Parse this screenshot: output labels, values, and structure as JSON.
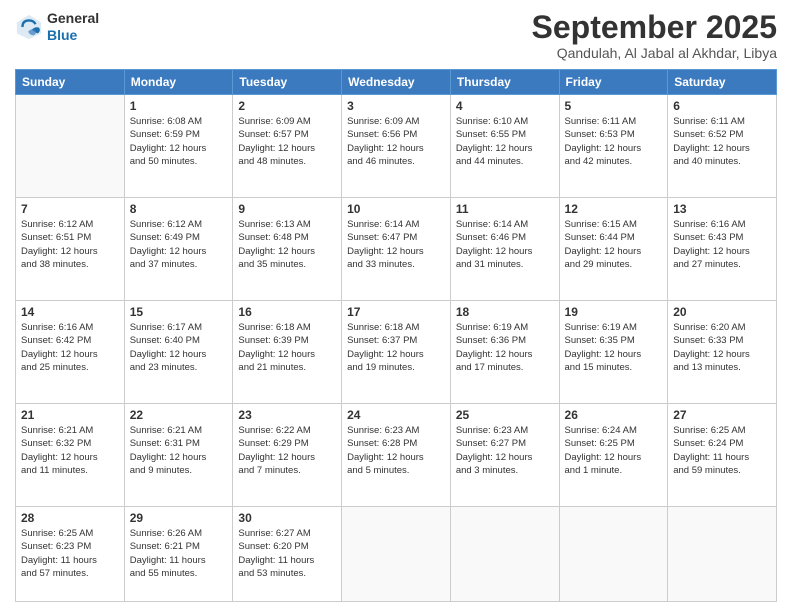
{
  "header": {
    "logo": {
      "line1": "General",
      "line2": "Blue"
    },
    "title": "September 2025",
    "location": "Qandulah, Al Jabal al Akhdar, Libya"
  },
  "weekdays": [
    "Sunday",
    "Monday",
    "Tuesday",
    "Wednesday",
    "Thursday",
    "Friday",
    "Saturday"
  ],
  "weeks": [
    [
      {
        "day": "",
        "info": ""
      },
      {
        "day": "1",
        "info": "Sunrise: 6:08 AM\nSunset: 6:59 PM\nDaylight: 12 hours\nand 50 minutes."
      },
      {
        "day": "2",
        "info": "Sunrise: 6:09 AM\nSunset: 6:57 PM\nDaylight: 12 hours\nand 48 minutes."
      },
      {
        "day": "3",
        "info": "Sunrise: 6:09 AM\nSunset: 6:56 PM\nDaylight: 12 hours\nand 46 minutes."
      },
      {
        "day": "4",
        "info": "Sunrise: 6:10 AM\nSunset: 6:55 PM\nDaylight: 12 hours\nand 44 minutes."
      },
      {
        "day": "5",
        "info": "Sunrise: 6:11 AM\nSunset: 6:53 PM\nDaylight: 12 hours\nand 42 minutes."
      },
      {
        "day": "6",
        "info": "Sunrise: 6:11 AM\nSunset: 6:52 PM\nDaylight: 12 hours\nand 40 minutes."
      }
    ],
    [
      {
        "day": "7",
        "info": "Sunrise: 6:12 AM\nSunset: 6:51 PM\nDaylight: 12 hours\nand 38 minutes."
      },
      {
        "day": "8",
        "info": "Sunrise: 6:12 AM\nSunset: 6:49 PM\nDaylight: 12 hours\nand 37 minutes."
      },
      {
        "day": "9",
        "info": "Sunrise: 6:13 AM\nSunset: 6:48 PM\nDaylight: 12 hours\nand 35 minutes."
      },
      {
        "day": "10",
        "info": "Sunrise: 6:14 AM\nSunset: 6:47 PM\nDaylight: 12 hours\nand 33 minutes."
      },
      {
        "day": "11",
        "info": "Sunrise: 6:14 AM\nSunset: 6:46 PM\nDaylight: 12 hours\nand 31 minutes."
      },
      {
        "day": "12",
        "info": "Sunrise: 6:15 AM\nSunset: 6:44 PM\nDaylight: 12 hours\nand 29 minutes."
      },
      {
        "day": "13",
        "info": "Sunrise: 6:16 AM\nSunset: 6:43 PM\nDaylight: 12 hours\nand 27 minutes."
      }
    ],
    [
      {
        "day": "14",
        "info": "Sunrise: 6:16 AM\nSunset: 6:42 PM\nDaylight: 12 hours\nand 25 minutes."
      },
      {
        "day": "15",
        "info": "Sunrise: 6:17 AM\nSunset: 6:40 PM\nDaylight: 12 hours\nand 23 minutes."
      },
      {
        "day": "16",
        "info": "Sunrise: 6:18 AM\nSunset: 6:39 PM\nDaylight: 12 hours\nand 21 minutes."
      },
      {
        "day": "17",
        "info": "Sunrise: 6:18 AM\nSunset: 6:37 PM\nDaylight: 12 hours\nand 19 minutes."
      },
      {
        "day": "18",
        "info": "Sunrise: 6:19 AM\nSunset: 6:36 PM\nDaylight: 12 hours\nand 17 minutes."
      },
      {
        "day": "19",
        "info": "Sunrise: 6:19 AM\nSunset: 6:35 PM\nDaylight: 12 hours\nand 15 minutes."
      },
      {
        "day": "20",
        "info": "Sunrise: 6:20 AM\nSunset: 6:33 PM\nDaylight: 12 hours\nand 13 minutes."
      }
    ],
    [
      {
        "day": "21",
        "info": "Sunrise: 6:21 AM\nSunset: 6:32 PM\nDaylight: 12 hours\nand 11 minutes."
      },
      {
        "day": "22",
        "info": "Sunrise: 6:21 AM\nSunset: 6:31 PM\nDaylight: 12 hours\nand 9 minutes."
      },
      {
        "day": "23",
        "info": "Sunrise: 6:22 AM\nSunset: 6:29 PM\nDaylight: 12 hours\nand 7 minutes."
      },
      {
        "day": "24",
        "info": "Sunrise: 6:23 AM\nSunset: 6:28 PM\nDaylight: 12 hours\nand 5 minutes."
      },
      {
        "day": "25",
        "info": "Sunrise: 6:23 AM\nSunset: 6:27 PM\nDaylight: 12 hours\nand 3 minutes."
      },
      {
        "day": "26",
        "info": "Sunrise: 6:24 AM\nSunset: 6:25 PM\nDaylight: 12 hours\nand 1 minute."
      },
      {
        "day": "27",
        "info": "Sunrise: 6:25 AM\nSunset: 6:24 PM\nDaylight: 11 hours\nand 59 minutes."
      }
    ],
    [
      {
        "day": "28",
        "info": "Sunrise: 6:25 AM\nSunset: 6:23 PM\nDaylight: 11 hours\nand 57 minutes."
      },
      {
        "day": "29",
        "info": "Sunrise: 6:26 AM\nSunset: 6:21 PM\nDaylight: 11 hours\nand 55 minutes."
      },
      {
        "day": "30",
        "info": "Sunrise: 6:27 AM\nSunset: 6:20 PM\nDaylight: 11 hours\nand 53 minutes."
      },
      {
        "day": "",
        "info": ""
      },
      {
        "day": "",
        "info": ""
      },
      {
        "day": "",
        "info": ""
      },
      {
        "day": "",
        "info": ""
      }
    ]
  ]
}
